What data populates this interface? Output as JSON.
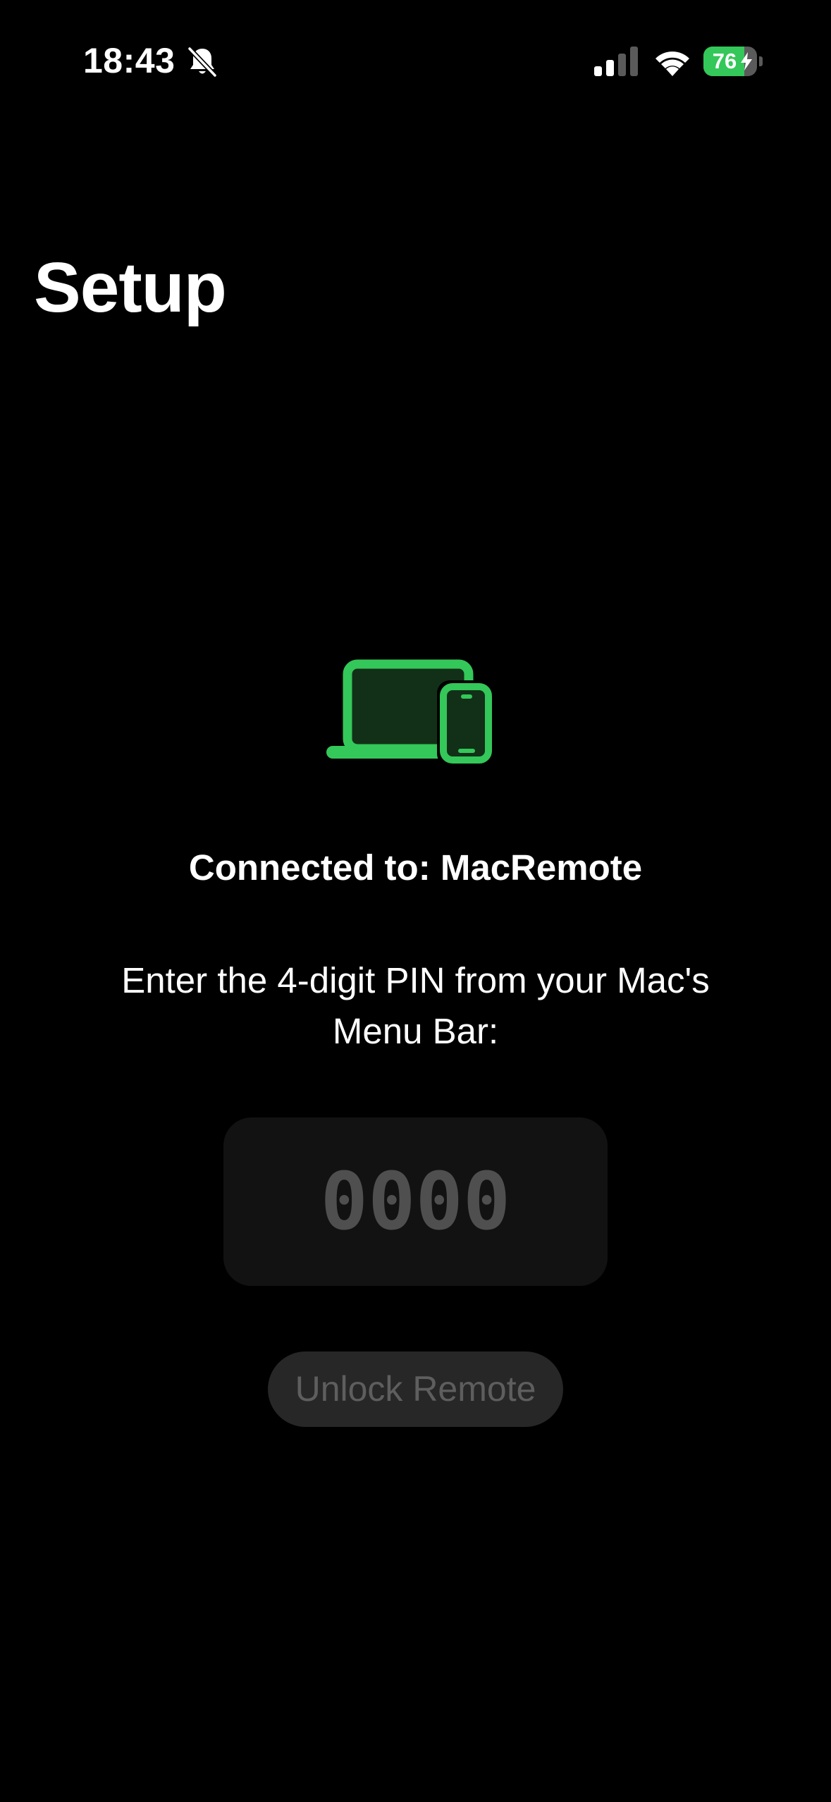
{
  "status_bar": {
    "time": "18:43",
    "silent_icon": "bell-slash-icon",
    "signal_icon": "cellular-signal-icon",
    "wifi_icon": "wifi-icon",
    "battery_percent": "76",
    "battery_level": 0.76,
    "battery_charging": true,
    "battery_color": "#34c759"
  },
  "page": {
    "title": "Setup"
  },
  "illustration": {
    "icon": "laptop-and-phone-icon",
    "accent_color": "#34c759"
  },
  "connection": {
    "label": "Connected to: MacRemote"
  },
  "instructions": {
    "text": "Enter the 4-digit PIN from your Mac's Menu Bar:"
  },
  "pin_input": {
    "value": "",
    "placeholder": "0000"
  },
  "unlock_button": {
    "label": "Unlock Remote",
    "enabled": false
  }
}
